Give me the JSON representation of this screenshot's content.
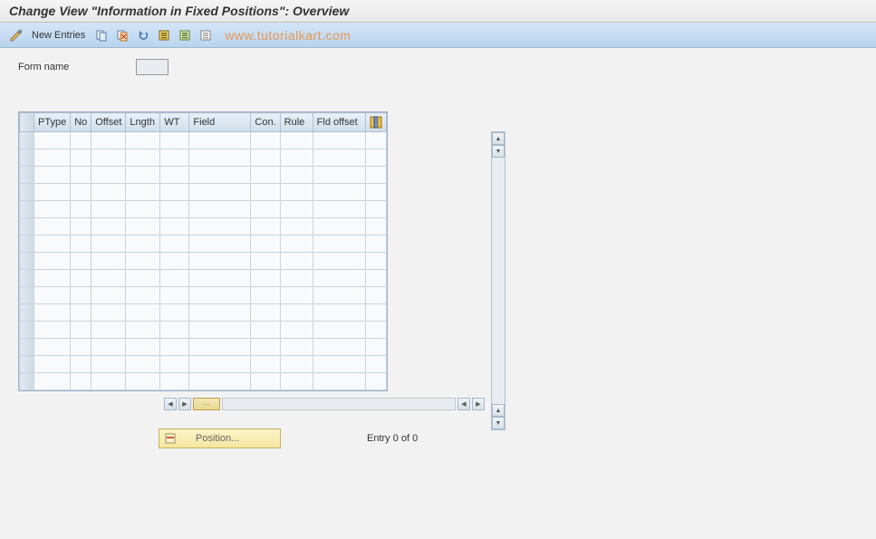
{
  "title": "Change View \"Information in Fixed Positions\": Overview",
  "toolbar": {
    "new_entries_label": "New Entries"
  },
  "watermark": "www.tutorialkart.com",
  "form": {
    "name_label": "Form name",
    "name_value": ""
  },
  "table": {
    "columns": {
      "ptype": "PType",
      "no": "No",
      "offset": "Offset",
      "lngth": "Lngth",
      "wt": "WT",
      "field": "Field",
      "con": "Con.",
      "rule": "Rule",
      "fld_offset": "Fld offset"
    }
  },
  "footer": {
    "position_label": "Position...",
    "entry_text": "Entry 0 of 0"
  }
}
